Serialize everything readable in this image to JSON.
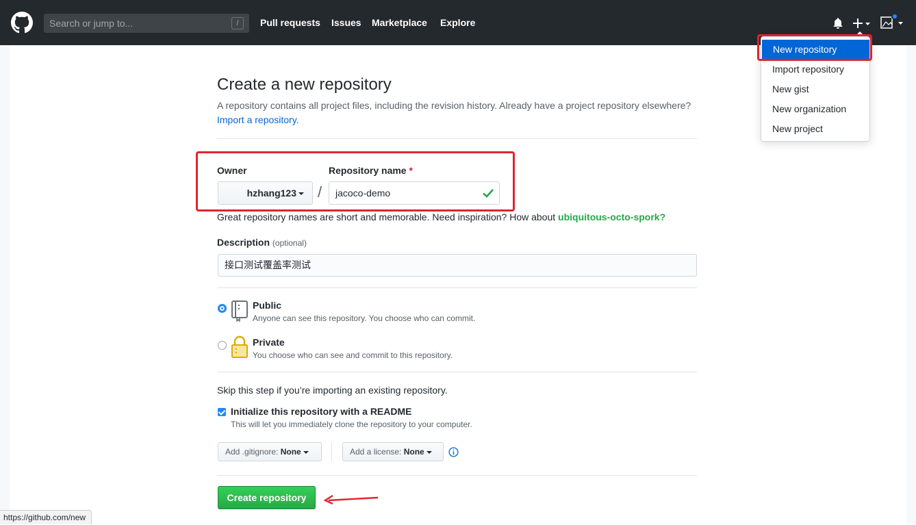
{
  "header": {
    "search_placeholder": "Search or jump to...",
    "search_shortcut": "/",
    "nav": [
      "Pull requests",
      "Issues",
      "Marketplace",
      "Explore"
    ]
  },
  "dropdown": {
    "items": [
      "New repository",
      "Import repository",
      "New gist",
      "New organization",
      "New project"
    ]
  },
  "page": {
    "title": "Create a new repository",
    "subtitle": "A repository contains all project files, including the revision history. Already have a project repository elsewhere?",
    "import_link": "Import a repository."
  },
  "form": {
    "owner_label": "Owner",
    "owner_value": "hzhang123",
    "separator": "/",
    "repo_label": "Repository name",
    "required_mark": "*",
    "repo_value": "jacoco-demo",
    "hint_prefix": "Great repository names are short and memorable. Need inspiration? How about",
    "hint_suggestion": "ubiquitous-octo-spork?",
    "description_label": "Description",
    "description_optional": "(optional)",
    "description_value": "接口测试覆盖率测试",
    "public_title": "Public",
    "public_desc": "Anyone can see this repository. You choose who can commit.",
    "private_title": "Private",
    "private_desc": "You choose who can see and commit to this repository.",
    "skip_text": "Skip this step if you’re importing an existing repository.",
    "init_title": "Initialize this repository with a README",
    "init_desc": "This will let you immediately clone the repository to your computer.",
    "gitignore_label": "Add .gitignore:",
    "gitignore_value": "None",
    "license_label": "Add a license:",
    "license_value": "None",
    "create_button": "Create repository"
  },
  "status_bar": {
    "url": "https://github.com/new"
  },
  "colors": {
    "header_bg": "#24292e",
    "accent": "#0366d6",
    "create_green": "#28a745",
    "annotation_red": "#e0242e"
  }
}
